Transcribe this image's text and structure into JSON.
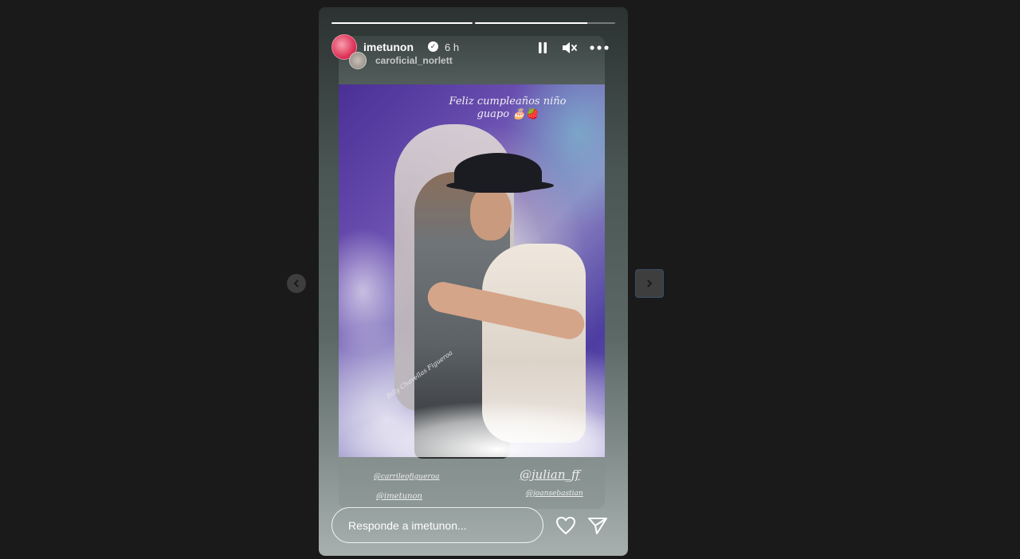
{
  "story": {
    "progress": [
      1,
      0.8
    ],
    "header": {
      "username": "imetunon",
      "verified_icon": "verified-badge-icon",
      "time": "6 h",
      "shared_from": "caroficial_norlett"
    },
    "controls": {
      "pause_icon": "pause-icon",
      "mute_icon": "muted-speaker-icon",
      "more_icon": "more-options-icon"
    },
    "media": {
      "greeting": "Feliz cumpleaños niño guapo 🎂🍓",
      "signature": "Billy Chavellas Figueroa",
      "tags": [
        "@carrileofigueroa",
        "@imetunon",
        "@julian_ff",
        "@joansebastian"
      ]
    },
    "footer": {
      "reply_placeholder": "Responde a imetunon...",
      "like_icon": "heart-icon",
      "share_icon": "send-icon"
    }
  },
  "navigation": {
    "prev_icon": "chevron-left-icon",
    "next_icon": "chevron-right-icon"
  }
}
